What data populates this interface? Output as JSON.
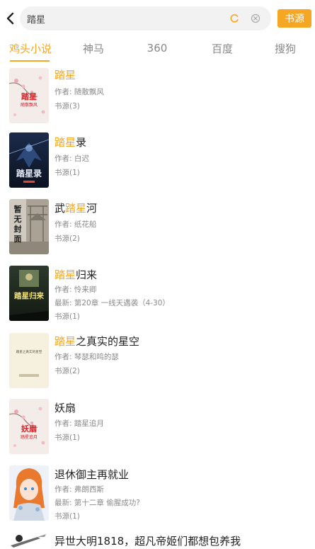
{
  "search": {
    "query": "踏星",
    "source_button": "书源"
  },
  "tabs": [
    {
      "label": "鸡头小说",
      "active": true
    },
    {
      "label": "神马",
      "active": false
    },
    {
      "label": "360",
      "active": false
    },
    {
      "label": "百度",
      "active": false
    },
    {
      "label": "搜狗",
      "active": false
    }
  ],
  "accent_color": "#f5a623",
  "books": [
    {
      "title_pre": "",
      "title_hl": "踏星",
      "title_post": "",
      "author": "作者: 随散飘风",
      "latest": "",
      "sources": "书源(3)",
      "cover_text": "踏星",
      "cover_sub": "随散飘风",
      "cover_style": "blossom"
    },
    {
      "title_pre": "",
      "title_hl": "踏星",
      "title_post": "录",
      "author": "作者: 白迟",
      "latest": "",
      "sources": "书源(1)",
      "cover_text": "踏星录",
      "cover_sub": "",
      "cover_style": "dark-blue"
    },
    {
      "title_pre": "武",
      "title_hl": "踏星",
      "title_post": "河",
      "author": "作者: 纸花船",
      "latest": "",
      "sources": "书源(2)",
      "cover_text": "暂无封面",
      "cover_sub": "",
      "cover_style": "placeholder"
    },
    {
      "title_pre": "",
      "title_hl": "踏星",
      "title_post": "归来",
      "author": "作者: 怜来卿",
      "latest": "最新: 第20章 一线天遇袭（4-30）",
      "sources": "书源(1)",
      "cover_text": "踏星归来",
      "cover_sub": "",
      "cover_style": "dark-green"
    },
    {
      "title_pre": "",
      "title_hl": "踏星",
      "title_post": "之真实的星空",
      "author": "作者: 琴瑟和鸣的瑟",
      "latest": "",
      "sources": "书源(2)",
      "cover_text": "踏星之真实的星空",
      "cover_sub": "",
      "cover_style": "cream"
    },
    {
      "title_pre": "妖扇",
      "title_hl": "",
      "title_post": "",
      "author": "作者: 踏星追月",
      "latest": "",
      "sources": "书源(1)",
      "cover_text": "妖扇",
      "cover_sub": "踏星追月",
      "cover_style": "blossom"
    },
    {
      "title_pre": "退休御主再就业",
      "title_hl": "",
      "title_post": "",
      "author": "作者: 弗朗西斯",
      "latest": "最新: 第十二章 偷腥成功?",
      "sources": "书源(1)",
      "cover_text": "",
      "cover_sub": "",
      "cover_style": "anime"
    },
    {
      "title_pre": "异世大明1818，超凡帝姬们都想包养我",
      "title_hl": "",
      "title_post": "",
      "author": "",
      "latest": "",
      "sources": "",
      "cover_text": "",
      "cover_sub": "",
      "cover_style": "sword"
    }
  ]
}
